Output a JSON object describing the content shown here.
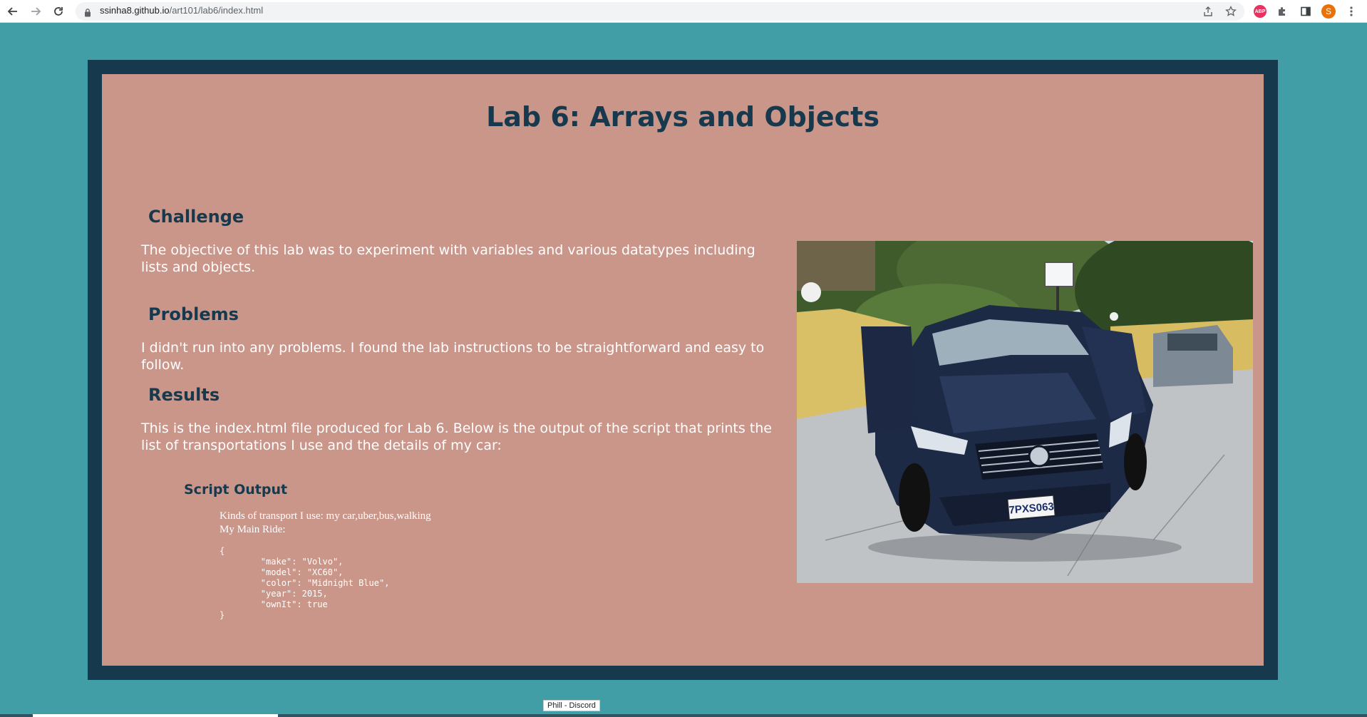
{
  "browser": {
    "url_host": "ssinha8.github.io",
    "url_path": "/art101/lab6/index.html",
    "avatar_letter": "S",
    "extension_abp_label": "ABP"
  },
  "page": {
    "title": "Lab 6: Arrays and Objects",
    "sections": {
      "challenge": {
        "heading": "Challenge",
        "text": "The objective of this lab was to experiment with variables and various datatypes including lists and objects."
      },
      "problems": {
        "heading": "Problems",
        "text": "I didn't run into any problems. I found the lab instructions to be straightforward and easy to follow."
      },
      "results": {
        "heading": "Results",
        "text": "This is the index.html file produced for Lab 6. Below is the output of the script that prints the list of transportations I use and the details of my car:"
      }
    },
    "script_output": {
      "heading": "Script Output",
      "transport_line": "Kinds of transport I use: my car,uber,bus,walking",
      "main_ride_line": "My Main Ride:",
      "json_text": "{\n\t\"make\": \"Volvo\",\n\t\"model\": \"XC60\",\n\t\"color\": \"Midnight Blue\",\n\t\"year\": 2015,\n\t\"ownIt\": true\n}"
    },
    "photo": {
      "license_plate": "7PXS063"
    }
  },
  "status_tooltip": "Phill - Discord",
  "colors": {
    "background": "#429ea6",
    "frame": "#17394d",
    "panel": "#cb968a",
    "heading": "#17394d",
    "body_text": "#ffffff"
  }
}
